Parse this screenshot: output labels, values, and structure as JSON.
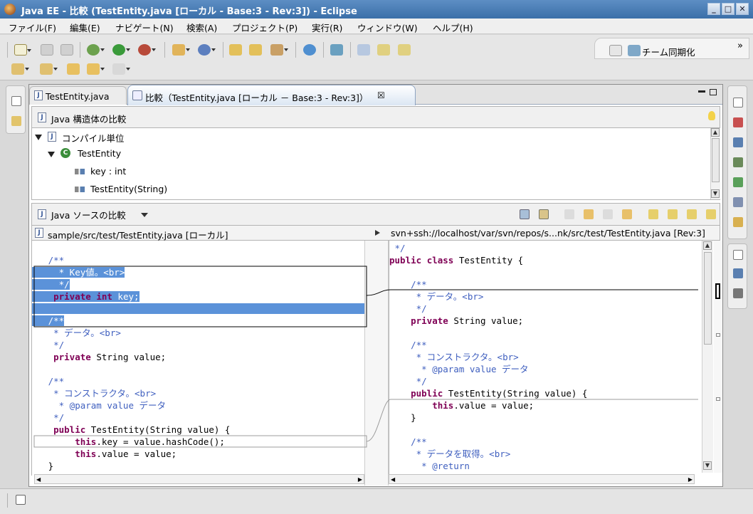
{
  "window": {
    "title": "Java EE - 比較 (TestEntity.java [ローカル - Base:3 - Rev:3]) - Eclipse",
    "minimize": "_",
    "maximize": "□",
    "close": "✕"
  },
  "menu": [
    "ファイル(F)",
    "編集(E)",
    "ナビゲート(N)",
    "検索(A)",
    "プロジェクト(P)",
    "実行(R)",
    "ウィンドウ(W)",
    "ヘルプ(H)"
  ],
  "toolbar": {
    "perspective_label": "チーム同期化",
    "overflow": "»"
  },
  "tabs": [
    {
      "label": "TestEntity.java",
      "active": false
    },
    {
      "label": "比較（TestEntity.java [ローカル － Base:3 - Rev:3]）",
      "active": true,
      "close": "☒"
    }
  ],
  "structure_compare": {
    "title": "Java 構造体の比較",
    "tree": [
      {
        "label": "コンパイル単位",
        "level": 0
      },
      {
        "label": "TestEntity",
        "level": 1
      },
      {
        "label": "key : int",
        "level": 2
      },
      {
        "label": "TestEntity(String)",
        "level": 2
      }
    ]
  },
  "source_compare": {
    "title": "Java ソースの比較",
    "left_path": "sample/src/test/TestEntity.java [ローカル]",
    "right_path": "svn+ssh://localhost/var/svn/repos/s...nk/src/test/TestEntity.java [Rev:3]",
    "left_lines": [
      {
        "text": "",
        "style": "plain"
      },
      {
        "text": "   /**",
        "style": "cm"
      },
      {
        "text": "     * Key値。<br>",
        "style": "cm-sel"
      },
      {
        "text": "     */",
        "style": "cm-sel"
      },
      {
        "text": "    private int key;",
        "style": "kw-sel"
      },
      {
        "text": "",
        "style": "blank-sel"
      },
      {
        "text": "   /**",
        "style": "cm-sel"
      },
      {
        "text": "    * データ。<br>",
        "style": "cm"
      },
      {
        "text": "    */",
        "style": "cm"
      },
      {
        "text": "    private String value;",
        "style": "kw"
      },
      {
        "text": "",
        "style": "plain"
      },
      {
        "text": "   /**",
        "style": "cm"
      },
      {
        "text": "    * コンストラクタ。<br>",
        "style": "cm"
      },
      {
        "text": "     * @param value データ",
        "style": "cm"
      },
      {
        "text": "    */",
        "style": "cm"
      },
      {
        "text": "    public TestEntity(String value) {",
        "style": "kw"
      },
      {
        "text": "        this.key = value.hashCode();",
        "style": "kw"
      },
      {
        "text": "        this.value = value;",
        "style": "kw"
      },
      {
        "text": "   }",
        "style": "plain"
      }
    ],
    "right_lines": [
      {
        "text": " */",
        "style": "cm"
      },
      {
        "text": "public class TestEntity {",
        "style": "kw"
      },
      {
        "text": "",
        "style": "plain"
      },
      {
        "text": "    /**",
        "style": "cm"
      },
      {
        "text": "     * データ。<br>",
        "style": "cm"
      },
      {
        "text": "     */",
        "style": "cm"
      },
      {
        "text": "    private String value;",
        "style": "kw"
      },
      {
        "text": "",
        "style": "plain"
      },
      {
        "text": "    /**",
        "style": "cm"
      },
      {
        "text": "     * コンストラクタ。<br>",
        "style": "cm"
      },
      {
        "text": "      * @param value データ",
        "style": "cm"
      },
      {
        "text": "     */",
        "style": "cm"
      },
      {
        "text": "    public TestEntity(String value) {",
        "style": "kw"
      },
      {
        "text": "        this.value = value;",
        "style": "kw"
      },
      {
        "text": "    }",
        "style": "plain"
      },
      {
        "text": "",
        "style": "plain"
      },
      {
        "text": "    /**",
        "style": "cm"
      },
      {
        "text": "     * データを取得。<br>",
        "style": "cm"
      },
      {
        "text": "      * @return",
        "style": "cm"
      }
    ]
  },
  "colors": {
    "selection": "#5b92d9",
    "keyword": "#7f0055",
    "comment": "#3f5fbf",
    "titlebar": "#4a7db7"
  }
}
